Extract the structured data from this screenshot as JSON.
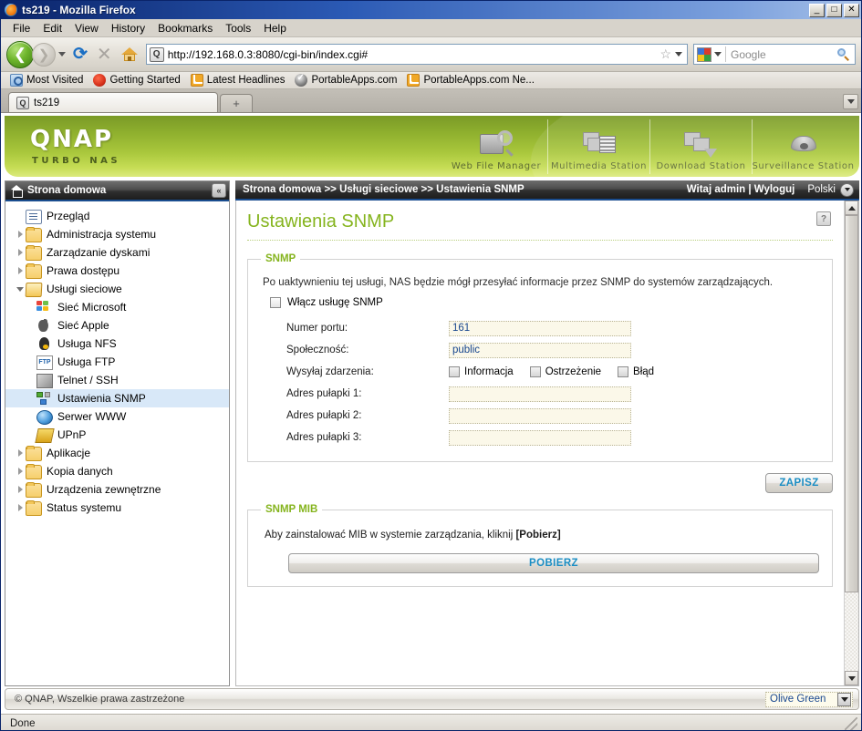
{
  "browser": {
    "window_title": "ts219 - Mozilla Firefox",
    "window_controls": {
      "minimize": "_",
      "maximize": "□",
      "close": "✕"
    },
    "menu": [
      {
        "label": "File"
      },
      {
        "label": "Edit"
      },
      {
        "label": "View"
      },
      {
        "label": "History"
      },
      {
        "label": "Bookmarks"
      },
      {
        "label": "Tools"
      },
      {
        "label": "Help"
      }
    ],
    "url": "http://192.168.0.3:8080/cgi-bin/index.cgi#",
    "favicon_text": "Q",
    "search_placeholder": "Google",
    "bookmarks": [
      {
        "label": "Most Visited",
        "icon": "most-visited-icon"
      },
      {
        "label": "Getting Started",
        "icon": "getting-started-icon"
      },
      {
        "label": "Latest Headlines",
        "icon": "rss-feed-icon"
      },
      {
        "label": "PortableApps.com",
        "icon": "portableapps-icon"
      },
      {
        "label": "PortableApps.com Ne...",
        "icon": "rss-feed-icon"
      }
    ],
    "tabs": [
      {
        "label": "ts219",
        "favicon_text": "Q"
      }
    ],
    "new_tab_label": "+",
    "status_text": "Done"
  },
  "banner": {
    "logo": "QNAP",
    "tagline": "TURBO NAS",
    "stations": [
      {
        "label": "Web File Manager",
        "icon": "web-file-manager-icon"
      },
      {
        "label": "Multimedia Station",
        "icon": "multimedia-station-icon"
      },
      {
        "label": "Download Station",
        "icon": "download-station-icon"
      },
      {
        "label": "Surveillance Station",
        "icon": "surveillance-station-icon"
      }
    ]
  },
  "sidebar": {
    "header": "Strona domowa",
    "collapse_label": "«",
    "items": [
      {
        "label": "Przegląd",
        "icon": "overview-icon",
        "level": 1,
        "expander": "none",
        "selected": false
      },
      {
        "label": "Administracja systemu",
        "icon": "folder-icon",
        "level": 1,
        "expander": "collapsed",
        "selected": false
      },
      {
        "label": "Zarządzanie dyskami",
        "icon": "folder-icon",
        "level": 1,
        "expander": "collapsed",
        "selected": false
      },
      {
        "label": "Prawa dostępu",
        "icon": "folder-icon",
        "level": 1,
        "expander": "collapsed",
        "selected": false
      },
      {
        "label": "Usługi sieciowe",
        "icon": "folder-open-icon",
        "level": 1,
        "expander": "expanded",
        "selected": false
      },
      {
        "label": "Sieć Microsoft",
        "icon": "windows-icon",
        "level": 2,
        "expander": "none",
        "selected": false
      },
      {
        "label": "Sieć Apple",
        "icon": "apple-icon",
        "level": 2,
        "expander": "none",
        "selected": false
      },
      {
        "label": "Usługa NFS",
        "icon": "linux-penguin-icon",
        "level": 2,
        "expander": "none",
        "selected": false
      },
      {
        "label": "Usługa FTP",
        "icon": "ftp-icon",
        "level": 2,
        "expander": "none",
        "selected": false
      },
      {
        "label": "Telnet / SSH",
        "icon": "terminal-icon",
        "level": 2,
        "expander": "none",
        "selected": false
      },
      {
        "label": "Ustawienia SNMP",
        "icon": "snmp-network-icon",
        "level": 2,
        "expander": "none",
        "selected": true
      },
      {
        "label": "Serwer WWW",
        "icon": "globe-icon",
        "level": 2,
        "expander": "none",
        "selected": false
      },
      {
        "label": "UPnP",
        "icon": "upnp-icon",
        "level": 2,
        "expander": "none",
        "selected": false
      },
      {
        "label": "Aplikacje",
        "icon": "folder-icon",
        "level": 1,
        "expander": "collapsed",
        "selected": false
      },
      {
        "label": "Kopia danych",
        "icon": "folder-icon",
        "level": 1,
        "expander": "collapsed",
        "selected": false
      },
      {
        "label": "Urządzenia zewnętrzne",
        "icon": "folder-icon",
        "level": 1,
        "expander": "collapsed",
        "selected": false
      },
      {
        "label": "Status systemu",
        "icon": "folder-icon",
        "level": 1,
        "expander": "collapsed",
        "selected": false
      }
    ]
  },
  "crumbbar": {
    "breadcrumb": "Strona domowa >> Usługi sieciowe >> Ustawienia SNMP",
    "welcome": "Witaj admin | Wyloguj",
    "language": "Polski"
  },
  "main": {
    "page_title": "Ustawienia SNMP",
    "help_label": "?",
    "snmp_section": {
      "legend": "SNMP",
      "description": "Po uaktywnieniu tej usługi, NAS będzie mógł przesyłać informacje przez SNMP do systemów zarządzających.",
      "enable_label": "Włącz usługę SNMP",
      "enable_checked": false,
      "fields": [
        {
          "label": "Numer portu:",
          "value": "161"
        },
        {
          "label": "Społeczność:",
          "value": "public"
        }
      ],
      "events_label": "Wysyłaj zdarzenia:",
      "events": [
        {
          "label": "Informacja",
          "checked": false
        },
        {
          "label": "Ostrzeżenie",
          "checked": false
        },
        {
          "label": "Błąd",
          "checked": false
        }
      ],
      "trap_fields": [
        {
          "label": "Adres pułapki 1:",
          "value": ""
        },
        {
          "label": "Adres pułapki 2:",
          "value": ""
        },
        {
          "label": "Adres pułapki 3:",
          "value": ""
        }
      ]
    },
    "save_button": "ZAPISZ",
    "mib_section": {
      "legend": "SNMP MIB",
      "text_before": "Aby zainstalować MIB w systemie zarządzania, kliknij ",
      "text_bold": "[Pobierz]",
      "download_button": "POBIERZ"
    }
  },
  "footer": {
    "copyright": "© QNAP, Wszelkie prawa zastrzeżone",
    "theme_selected": "Olive Green"
  },
  "colors": {
    "accent_green": "#85b41e",
    "button_blue": "#1b8ec4",
    "field_bg": "#fbf8e9",
    "field_text": "#17468e",
    "selected_row": "#d8e8f8"
  }
}
